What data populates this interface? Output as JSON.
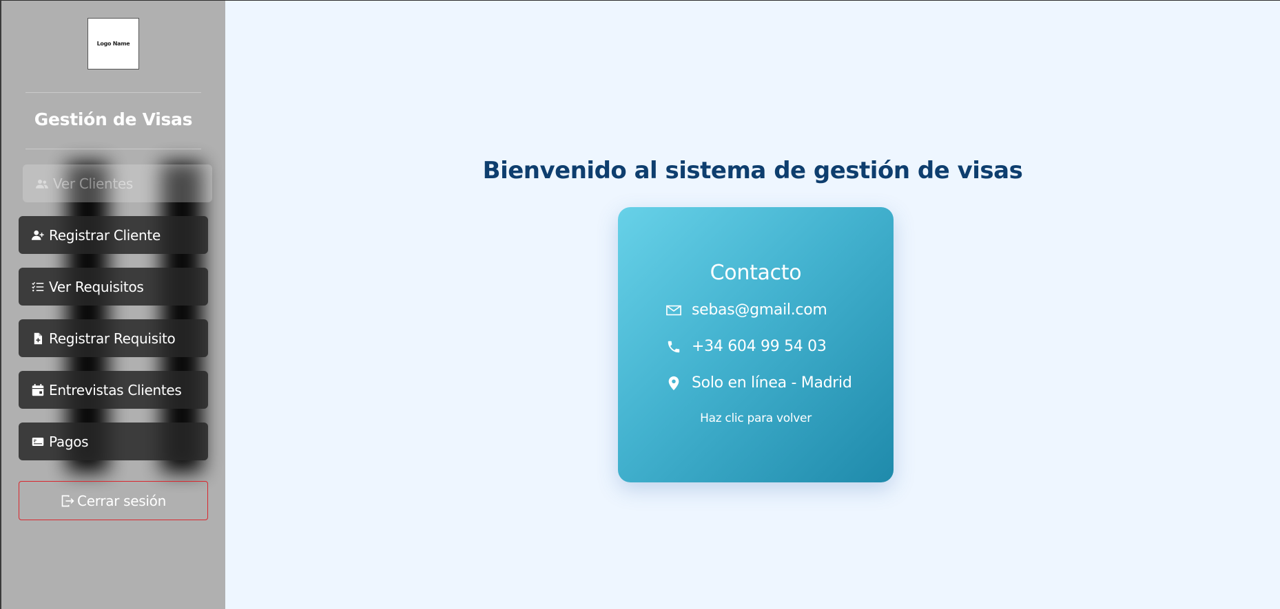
{
  "sidebar": {
    "logo_text": "Logo Name",
    "brand": "Gestión de Visas",
    "items": [
      {
        "label": "Ver Clientes",
        "icon": "users-icon",
        "active": true
      },
      {
        "label": "Registrar Cliente",
        "icon": "user-plus-icon"
      },
      {
        "label": "Ver Requisitos",
        "icon": "list-check-icon"
      },
      {
        "label": "Registrar Requisito",
        "icon": "file-plus-icon"
      },
      {
        "label": "Entrevistas Clientes",
        "icon": "calendar-icon"
      },
      {
        "label": "Pagos",
        "icon": "credit-card-icon"
      }
    ],
    "logout_label": "Cerrar sesión",
    "logout_icon": "logout-icon"
  },
  "main": {
    "welcome": "Bienvenido al sistema de gestión de visas",
    "card": {
      "title": "Contacto",
      "email": "sebas@gmail.com",
      "phone": "+34 604 99 54 03",
      "location": "Solo en línea - Madrid",
      "hint": "Haz clic para volver"
    }
  },
  "colors": {
    "background": "#eef6ff",
    "sidebar": "#b0b0b0",
    "heading": "#0e3e6e",
    "card_gradient_start": "#67d1e8",
    "card_gradient_end": "#1f8aab",
    "logout_border": "#d9262d"
  }
}
